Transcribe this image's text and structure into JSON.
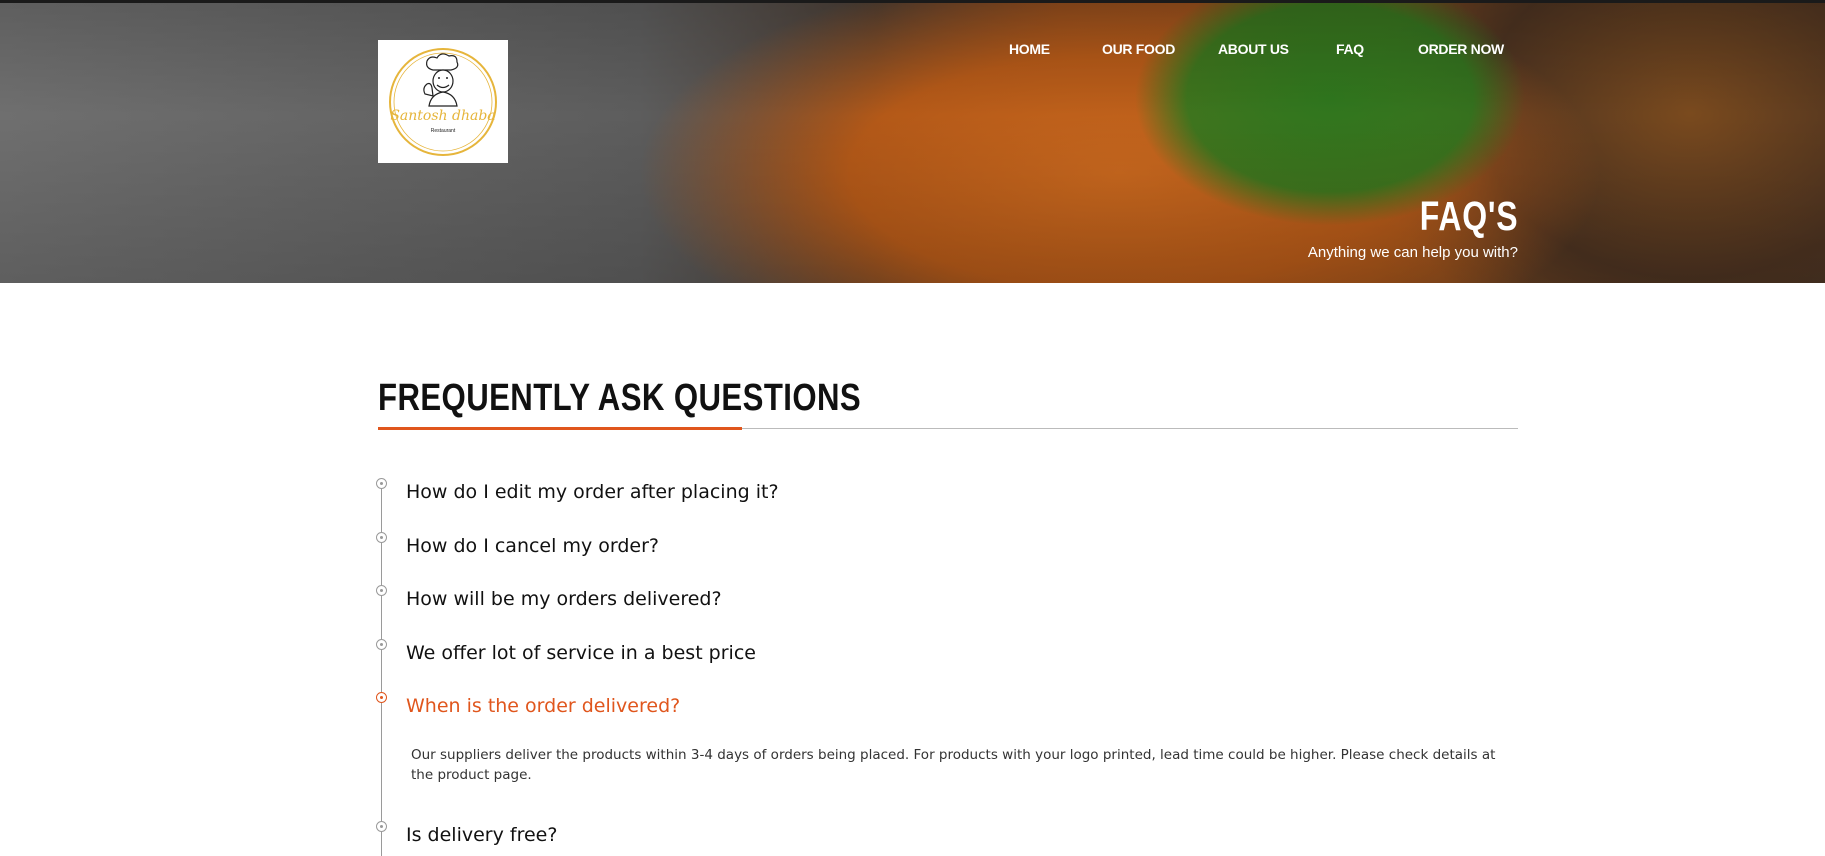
{
  "header": {
    "logo": {
      "name": "Santosh dhaba",
      "tagline": "Restaurant",
      "icon": "chef-icon",
      "ring_color": "#e6b53b"
    },
    "nav": [
      {
        "label": "HOME"
      },
      {
        "label": "OUR FOOD"
      },
      {
        "label": "ABOUT US"
      },
      {
        "label": "FAQ"
      },
      {
        "label": "ORDER NOW"
      }
    ],
    "hero_title": "FAQ'S",
    "hero_subtitle": "Anything we can help you with?"
  },
  "main": {
    "section_title": "FREQUENTLY ASK QUESTIONS",
    "accent_color": "#e0561d",
    "faqs": [
      {
        "question": "How do I edit my order after placing it?"
      },
      {
        "question": "How do I cancel my order?"
      },
      {
        "question": "How will be my orders delivered?"
      },
      {
        "question": "We offer lot of service in a best price"
      },
      {
        "question": "When is the order delivered?",
        "expanded": true,
        "answer": "Our suppliers deliver the products within 3-4 days of orders being placed. For products with your logo printed, lead time could be higher. Please check details at the product page."
      },
      {
        "question": "Is delivery free?"
      }
    ]
  }
}
